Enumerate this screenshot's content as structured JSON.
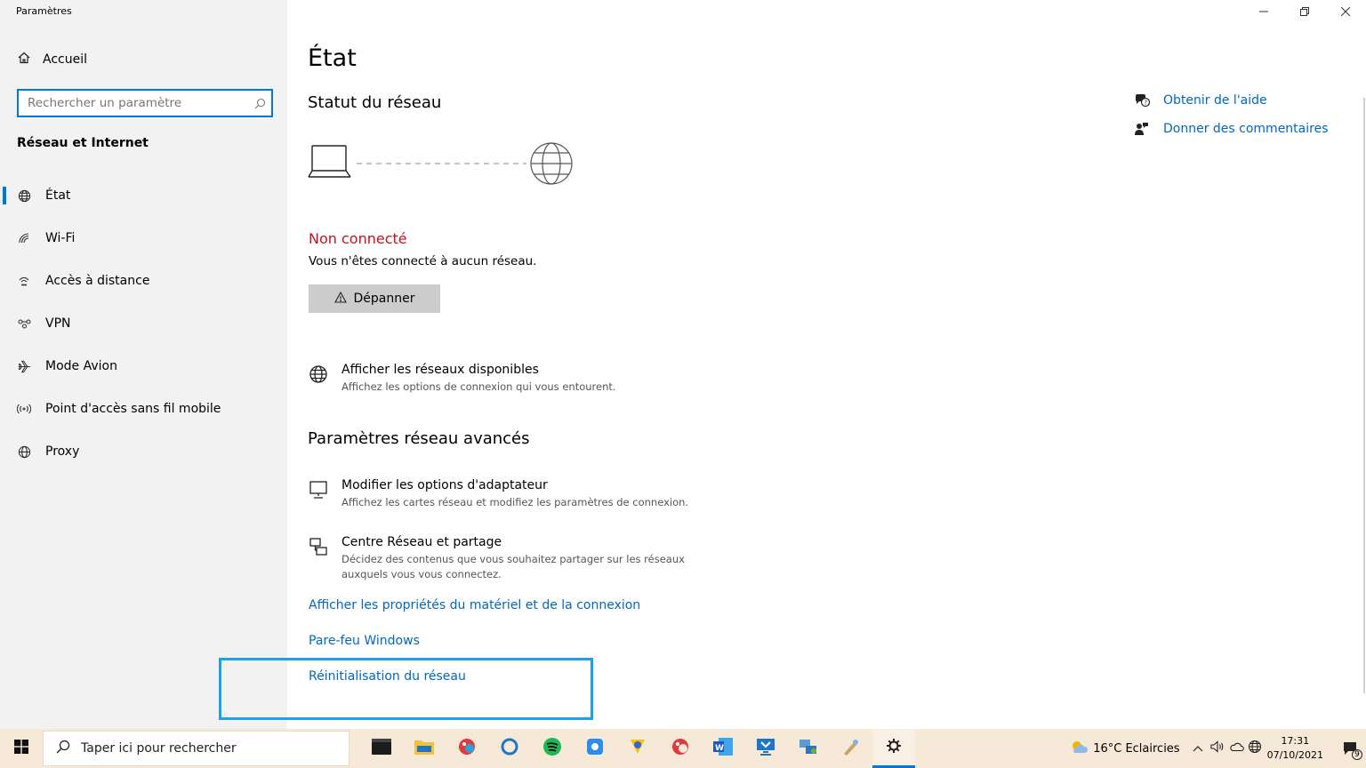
{
  "window": {
    "title": "Paramètres"
  },
  "sidebar": {
    "home_label": "Accueil",
    "search_placeholder": "Rechercher un paramètre",
    "section_title": "Réseau et Internet",
    "items": [
      {
        "label": "État",
        "icon": "globe-icon",
        "active": true
      },
      {
        "label": "Wi-Fi",
        "icon": "wifi-icon"
      },
      {
        "label": "Accès à distance",
        "icon": "dialup-icon"
      },
      {
        "label": "VPN",
        "icon": "vpn-icon"
      },
      {
        "label": "Mode Avion",
        "icon": "airplane-icon"
      },
      {
        "label": "Point d'accès sans fil mobile",
        "icon": "hotspot-icon"
      },
      {
        "label": "Proxy",
        "icon": "globe-icon"
      }
    ]
  },
  "main": {
    "title": "État",
    "network_status_heading": "Statut du réseau",
    "status_text": "Non connecté",
    "status_desc": "Vous n'êtes connecté à aucun réseau.",
    "troubleshoot_label": "Dépanner",
    "available": {
      "title": "Afficher les réseaux disponibles",
      "desc": "Affichez les options de connexion qui vous entourent."
    },
    "advanced_heading": "Paramètres réseau avancés",
    "adapter": {
      "title": "Modifier les options d'adaptateur",
      "desc": "Affichez les cartes réseau et modifiez les paramètres de connexion."
    },
    "sharing": {
      "title": "Centre Réseau et partage",
      "desc1": "Décidez des contenus que vous souhaitez partager sur les réseaux",
      "desc2": "auxquels vous vous connectez."
    },
    "links": {
      "hardware": "Afficher les propriétés du matériel et de la connexion",
      "firewall": "Pare-feu Windows",
      "reset": "Réinitialisation du réseau"
    }
  },
  "help": {
    "get_help": "Obtenir de l'aide",
    "feedback": "Donner des commentaires"
  },
  "taskbar": {
    "search_placeholder": "Taper ici pour rechercher",
    "weather": "16°C  Eclaircies",
    "time": "17:31",
    "date": "07/10/2021",
    "notification_count": "9"
  },
  "colors": {
    "accent": "#0078d7",
    "link": "#0067c0",
    "error": "#c50f1f",
    "highlight": "#1aa3e8"
  }
}
